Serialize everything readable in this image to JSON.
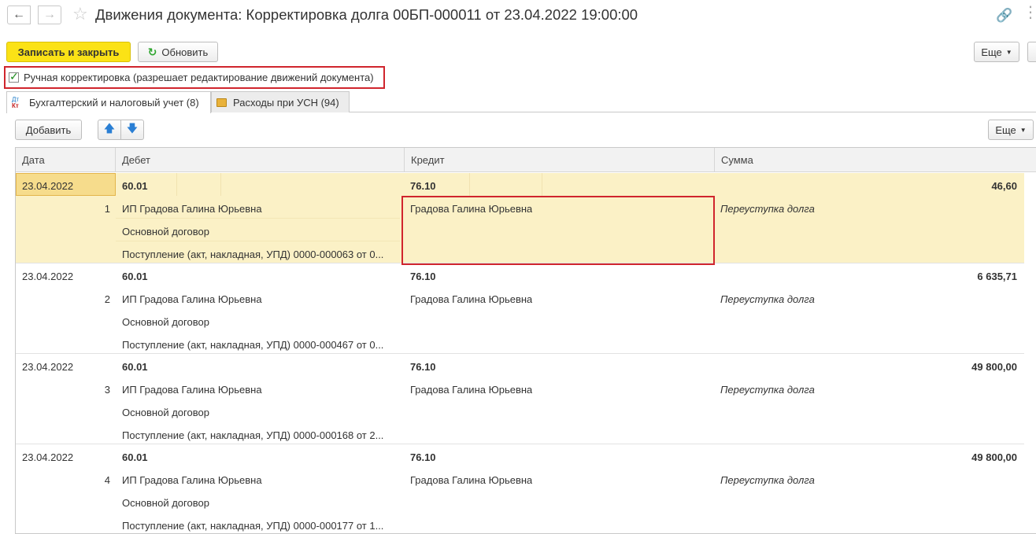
{
  "window": {
    "title": "Движения документа: Корректировка долга 00БП-000011 от 23.04.2022 19:00:00"
  },
  "toolbar": {
    "save_close_label": "Записать и закрыть",
    "refresh_label": "Обновить",
    "more_label": "Еще"
  },
  "manual_adjustment": {
    "checked": true,
    "label": "Ручная корректировка (разрешает редактирование движений документа)"
  },
  "tabs": [
    {
      "label": "Бухгалтерский и налоговый учет (8)",
      "active": true
    },
    {
      "label": "Расходы при УСН (94)",
      "active": false
    }
  ],
  "table_toolbar": {
    "add_label": "Добавить",
    "more_label": "Еще"
  },
  "table": {
    "columns": [
      "Дата",
      "Дебет",
      "Кредит",
      "Сумма"
    ],
    "rows": [
      {
        "date": "23.04.2022",
        "number": "1",
        "debit_account": "60.01",
        "debit_subconto": [
          "ИП Градова Галина Юрьевна",
          "Основной договор",
          "Поступление (акт, накладная, УПД) 0000-000063 от 0..."
        ],
        "credit_account": "76.10",
        "credit_subconto": "Градова Галина Юрьевна",
        "amount": "46,60",
        "purpose": "Переуступка долга",
        "selected": true
      },
      {
        "date": "23.04.2022",
        "number": "2",
        "debit_account": "60.01",
        "debit_subconto": [
          "ИП Градова Галина Юрьевна",
          "Основной договор",
          "Поступление (акт, накладная, УПД) 0000-000467 от 0..."
        ],
        "credit_account": "76.10",
        "credit_subconto": "Градова Галина Юрьевна",
        "amount": "6 635,71",
        "purpose": "Переуступка долга",
        "selected": false
      },
      {
        "date": "23.04.2022",
        "number": "3",
        "debit_account": "60.01",
        "debit_subconto": [
          "ИП Градова Галина Юрьевна",
          "Основной договор",
          "Поступление (акт, накладная, УПД) 0000-000168 от 2..."
        ],
        "credit_account": "76.10",
        "credit_subconto": "Градова Галина Юрьевна",
        "amount": "49 800,00",
        "purpose": "Переуступка долга",
        "selected": false
      },
      {
        "date": "23.04.2022",
        "number": "4",
        "debit_account": "60.01",
        "debit_subconto": [
          "ИП Градова Галина Юрьевна",
          "Основной договор",
          "Поступление (акт, накладная, УПД) 0000-000177 от 1..."
        ],
        "credit_account": "76.10",
        "credit_subconto": "Градова Галина Юрьевна",
        "amount": "49 800,00",
        "purpose": "Переуступка долга",
        "selected": false
      }
    ]
  }
}
